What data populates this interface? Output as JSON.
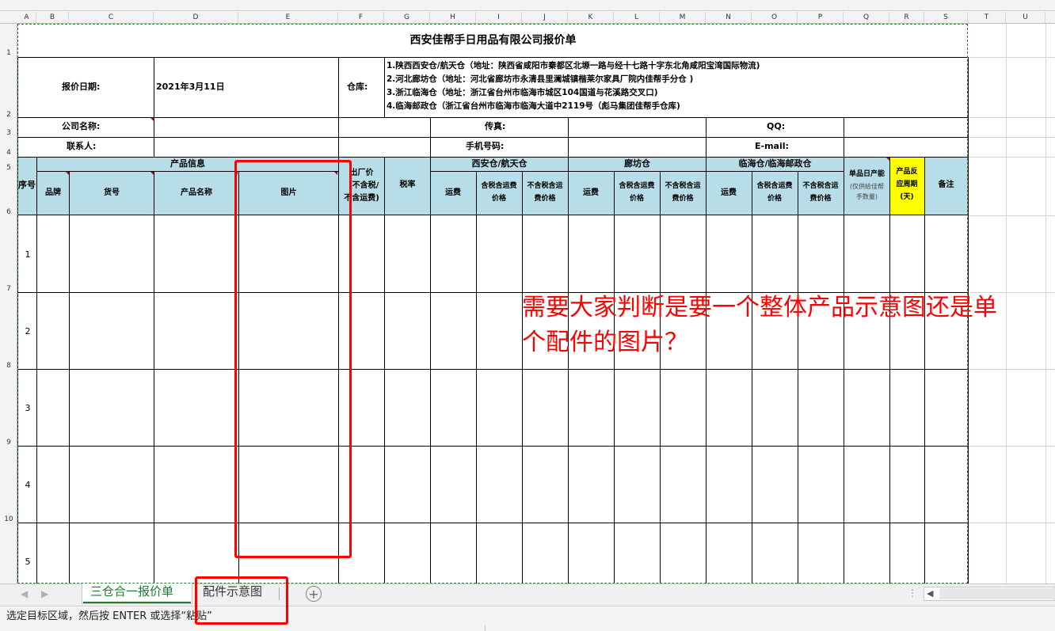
{
  "sheet": {
    "title": "西安佳帮手日用品有限公司报价单",
    "quote_date_label": "报价日期:",
    "quote_date_value": "2021年3月11日",
    "warehouse_label": "仓库:",
    "warehouse_lines": [
      "1.陕西西安仓/航天仓（地址：陕西省咸阳市秦都区北塬一路与经十七路十字东北角咸阳宝湾国际物流)",
      "2.河北廊坊仓（地址：河北省廊坊市永清县里澜城镇楷莱尔家具厂院内佳帮手分仓 )",
      "3.浙江临海仓（地址：浙江省台州市临海市城区104国道与花溪路交叉口)",
      "4.临海邮政仓（浙江省台州市临海市临海大道中2119号（彪马集团佳帮手仓库)"
    ],
    "company_label": "公司名称:",
    "fax_label": "传真:",
    "qq_label": "QQ:",
    "contact_label": "联系人:",
    "phone_label": "手机号码:",
    "email_label": "E-mail:"
  },
  "table_header": {
    "seq": "序号",
    "product_info": "产品信息",
    "brand": "品牌",
    "item_no": "货号",
    "product_name": "产品名称",
    "picture": "图片",
    "factory_price": [
      "出厂价",
      "（不含税/",
      "不含运费)"
    ],
    "tax_rate": "税率",
    "group_xian": "西安仓/航天仓",
    "group_langfang": "廊坊仓",
    "group_linhai": "临海仓/临海邮政仓",
    "freight": "运费",
    "with_tax_freight": [
      "含税含运费",
      "价格"
    ],
    "without_tax_freight": [
      "不含税含运",
      "费价格"
    ],
    "daily_capacity": "单品日产能",
    "daily_capacity_note": [
      "(仅供给佳帮",
      "手数量)"
    ],
    "feedback_cycle": [
      "产品反",
      "应周期",
      "(天)"
    ],
    "remarks": "备注"
  },
  "rows": [
    "1",
    "2",
    "3",
    "4",
    "5"
  ],
  "column_letters": [
    "A",
    "B",
    "C",
    "D",
    "E",
    "F",
    "G",
    "H",
    "I",
    "J",
    "K",
    "L",
    "M",
    "N",
    "O",
    "P",
    "Q",
    "R",
    "S",
    "T",
    "U"
  ],
  "row_numbers": [
    "1",
    "2",
    "3",
    "4",
    "5",
    "6",
    "7",
    "8",
    "9",
    "10"
  ],
  "annotation": {
    "line1": "需要大家判断是要一个整体产品示意图还是单",
    "line2": "个配件的图片？",
    "color": "#ff0000"
  },
  "tabs": [
    {
      "label": "三仓合一报价单",
      "active": true
    },
    {
      "label": "配件示意图",
      "active": false
    }
  ],
  "status_bar": {
    "message": "选定目标区域，然后按 ENTER 或选择“粘贴”"
  },
  "colors": {
    "header_fill": "#b7dee8",
    "highlight_fill": "#ffff00",
    "active_tab_text": "#1e7b34"
  }
}
